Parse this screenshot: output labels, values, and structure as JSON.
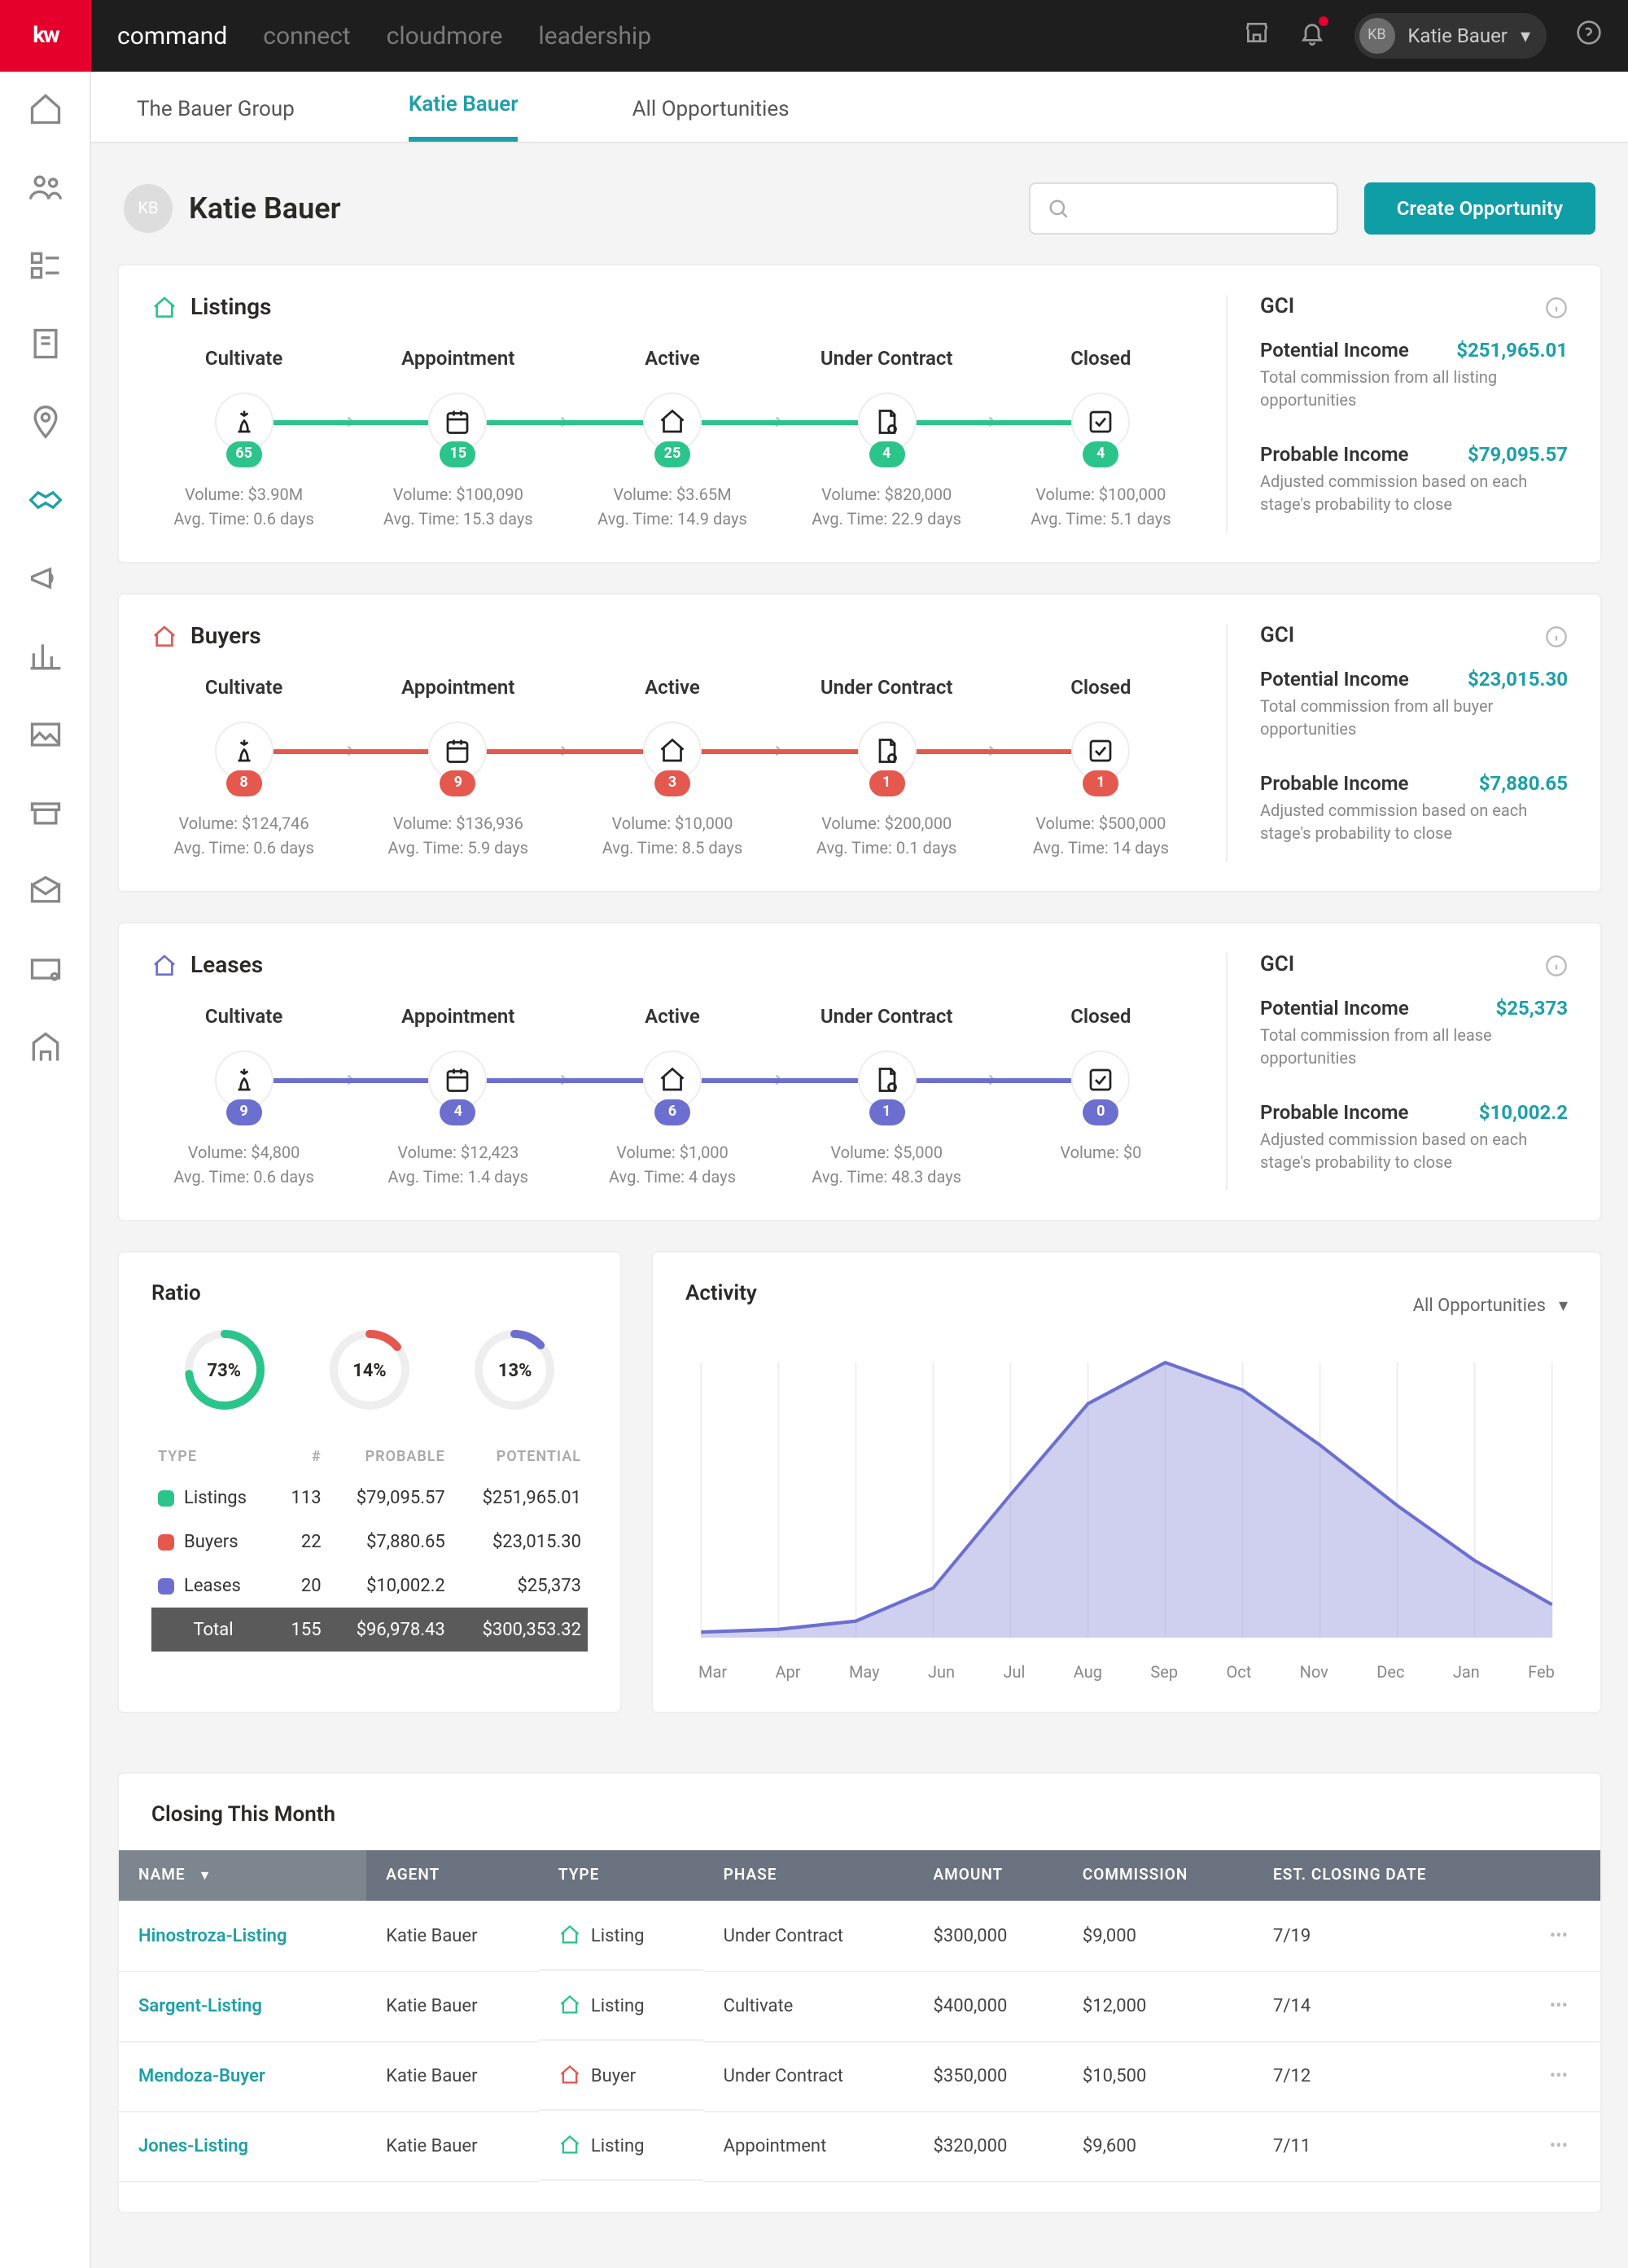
{
  "topnav": {
    "logo": "kw",
    "items": [
      "command",
      "connect",
      "cloudmore",
      "leadership"
    ],
    "user_initials": "KB",
    "user_name": "Katie Bauer"
  },
  "tabs": [
    "The Bauer Group",
    "Katie Bauer",
    "All Opportunities"
  ],
  "active_tab": 1,
  "hero": {
    "initials": "KB",
    "name": "Katie Bauer",
    "cta": "Create Opportunity"
  },
  "pipelines": [
    {
      "key": "listings",
      "title": "Listings",
      "color": "#2BC48A",
      "css": "c-green-l",
      "stages": [
        {
          "label": "Cultivate",
          "count": 65,
          "volume": "$3.90M",
          "avg": "0.6 days"
        },
        {
          "label": "Appointment",
          "count": 15,
          "volume": "$100,090",
          "avg": "15.3 days"
        },
        {
          "label": "Active",
          "count": 25,
          "volume": "$3.65M",
          "avg": "14.9 days"
        },
        {
          "label": "Under Contract",
          "count": 4,
          "volume": "$820,000",
          "avg": "22.9 days"
        },
        {
          "label": "Closed",
          "count": 4,
          "volume": "$100,000",
          "avg": "5.1 days"
        }
      ],
      "gci": {
        "potential_label": "Potential Income",
        "potential": "$251,965.01",
        "potential_desc": "Total commission from all listing opportunities",
        "probable_label": "Probable Income",
        "probable": "$79,095.57",
        "probable_desc": "Adjusted commission based on each stage's probability to close"
      }
    },
    {
      "key": "buyers",
      "title": "Buyers",
      "color": "#E4584E",
      "css": "c-red-l",
      "stages": [
        {
          "label": "Cultivate",
          "count": 8,
          "volume": "$124,746",
          "avg": "0.6 days"
        },
        {
          "label": "Appointment",
          "count": 9,
          "volume": "$136,936",
          "avg": "5.9 days"
        },
        {
          "label": "Active",
          "count": 3,
          "volume": "$10,000",
          "avg": "8.5 days"
        },
        {
          "label": "Under Contract",
          "count": 1,
          "volume": "$200,000",
          "avg": "0.1 days"
        },
        {
          "label": "Closed",
          "count": 1,
          "volume": "$500,000",
          "avg": "14 days"
        }
      ],
      "gci": {
        "potential_label": "Potential Income",
        "potential": "$23,015.30",
        "potential_desc": "Total commission from all buyer opportunities",
        "probable_label": "Probable Income",
        "probable": "$7,880.65",
        "probable_desc": "Adjusted commission based on each stage's probability to close"
      }
    },
    {
      "key": "leases",
      "title": "Leases",
      "color": "#6C6FCF",
      "css": "c-purple-l",
      "stages": [
        {
          "label": "Cultivate",
          "count": 9,
          "volume": "$4,800",
          "avg": "0.6 days"
        },
        {
          "label": "Appointment",
          "count": 4,
          "volume": "$12,423",
          "avg": "1.4 days"
        },
        {
          "label": "Active",
          "count": 6,
          "volume": "$1,000",
          "avg": "4 days"
        },
        {
          "label": "Under Contract",
          "count": 1,
          "volume": "$5,000",
          "avg": "48.3 days"
        },
        {
          "label": "Closed",
          "count": 0,
          "volume": "$0",
          "avg": null
        }
      ],
      "gci": {
        "potential_label": "Potential Income",
        "potential": "$25,373",
        "potential_desc": "Total commission from all lease opportunities",
        "probable_label": "Probable Income",
        "probable": "$10,002.2",
        "probable_desc": "Adjusted commission based on each stage's probability to close"
      }
    }
  ],
  "ratio": {
    "title": "Ratio",
    "donuts": [
      {
        "pct": 73,
        "color": "#2BC48A"
      },
      {
        "pct": 14,
        "color": "#E4584E"
      },
      {
        "pct": 13,
        "color": "#6C6FCF"
      }
    ],
    "headers": [
      "TYPE",
      "#",
      "PROBABLE",
      "POTENTIAL"
    ],
    "rows": [
      {
        "sw": "#2BC48A",
        "type": "Listings",
        "n": 113,
        "prob": "$79,095.57",
        "pot": "$251,965.01"
      },
      {
        "sw": "#E4584E",
        "type": "Buyers",
        "n": 22,
        "prob": "$7,880.65",
        "pot": "$23,015.30"
      },
      {
        "sw": "#6C6FCF",
        "type": "Leases",
        "n": 20,
        "prob": "$10,002.2",
        "pot": "$25,373"
      }
    ],
    "total": {
      "label": "Total",
      "n": 155,
      "prob": "$96,978.43",
      "pot": "$300,353.32"
    }
  },
  "activity": {
    "title": "Activity",
    "filter": "All Opportunities"
  },
  "chart_data": {
    "type": "area",
    "title": "Activity",
    "xlabel": "",
    "ylabel": "",
    "categories": [
      "Mar",
      "Apr",
      "May",
      "Jun",
      "Jul",
      "Aug",
      "Sep",
      "Oct",
      "Nov",
      "Dec",
      "Jan",
      "Feb"
    ],
    "values": [
      2,
      3,
      6,
      18,
      52,
      85,
      100,
      90,
      70,
      48,
      28,
      12
    ],
    "ylim": [
      0,
      100
    ]
  },
  "closing": {
    "title": "Closing This Month",
    "headers": [
      "NAME",
      "AGENT",
      "TYPE",
      "PHASE",
      "AMOUNT",
      "COMMISSION",
      "EST. CLOSING DATE"
    ],
    "rows": [
      {
        "name": "Hinostroza-Listing",
        "agent": "Katie Bauer",
        "type": "Listing",
        "type_color": "#2BC48A",
        "phase": "Under Contract",
        "amount": "$300,000",
        "commission": "$9,000",
        "date": "7/19"
      },
      {
        "name": "Sargent-Listing",
        "agent": "Katie Bauer",
        "type": "Listing",
        "type_color": "#2BC48A",
        "phase": "Cultivate",
        "amount": "$400,000",
        "commission": "$12,000",
        "date": "7/14"
      },
      {
        "name": "Mendoza-Buyer",
        "agent": "Katie Bauer",
        "type": "Buyer",
        "type_color": "#E4584E",
        "phase": "Under Contract",
        "amount": "$350,000",
        "commission": "$10,500",
        "date": "7/12"
      },
      {
        "name": "Jones-Listing",
        "agent": "Katie Bauer",
        "type": "Listing",
        "type_color": "#2BC48A",
        "phase": "Appointment",
        "amount": "$320,000",
        "commission": "$9,600",
        "date": "7/11"
      }
    ]
  },
  "labels": {
    "gci": "GCI",
    "volume": "Volume: ",
    "avg": "Avg. Time: "
  }
}
